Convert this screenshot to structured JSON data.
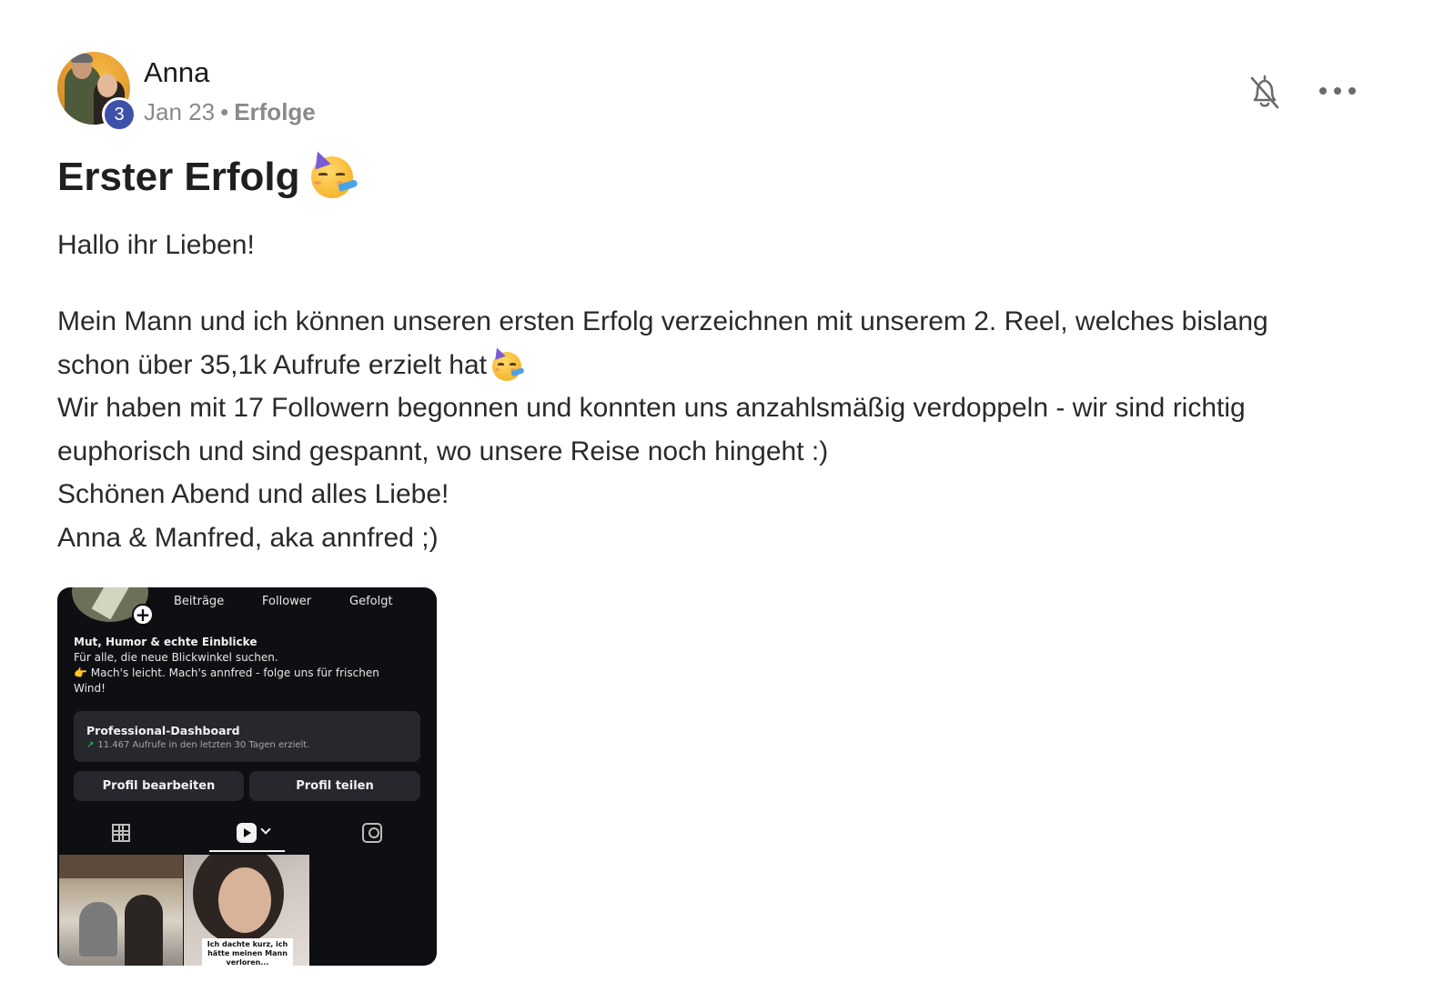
{
  "post": {
    "author": {
      "name": "Anna",
      "level": "3"
    },
    "meta": {
      "date": "Jan 23",
      "separator": "•",
      "category": "Erfolge"
    },
    "actions": {
      "notification_icon": "bell-off-icon",
      "more_icon": "more-horizontal-icon"
    },
    "title": "Erster Erfolg",
    "title_emoji": "partying-face",
    "greeting": "Hallo ihr Lieben!",
    "paragraph_lines": [
      "Mein Mann und ich können unseren ersten Erfolg verzeichnen mit unserem 2. Reel, welches bislang",
      "schon über 35,1k Aufrufe erzielt hat",
      "Wir haben mit 17 Followern begonnen und konnten uns anzahlsmäßig verdoppeln - wir sind richtig",
      "euphorisch und sind gespannt, wo unsere Reise noch hingeht :)",
      "Schönen Abend und alles Liebe!",
      "Anna & Manfred, aka annfred ;)"
    ]
  },
  "attachment": {
    "stats": [
      "Beiträge",
      "Follower",
      "Gefolgt"
    ],
    "bio_name": "Mut, Humor & echte Einblicke",
    "bio_lines": [
      "Für alle, die neue Blickwinkel suchen.",
      "👉 Mach's leicht. Mach's annfred - folge uns für frischen",
      "Wind!"
    ],
    "dashboard_title": "Professional-Dashboard",
    "dashboard_arrow": "↗",
    "dashboard_sub": "11.467 Aufrufe in den letzten 30 Tagen erzielt.",
    "edit_profile": "Profil bearbeiten",
    "share_profile": "Profil teilen",
    "thumb_caption": "Ich dachte kurz, ich hätte meinen Mann verloren..."
  },
  "colors": {
    "badge": "#3d51a8",
    "text": "#1f1f1f",
    "muted": "#8a8a8a",
    "ig_background": "#0e0f12",
    "ig_button": "#26282d"
  }
}
